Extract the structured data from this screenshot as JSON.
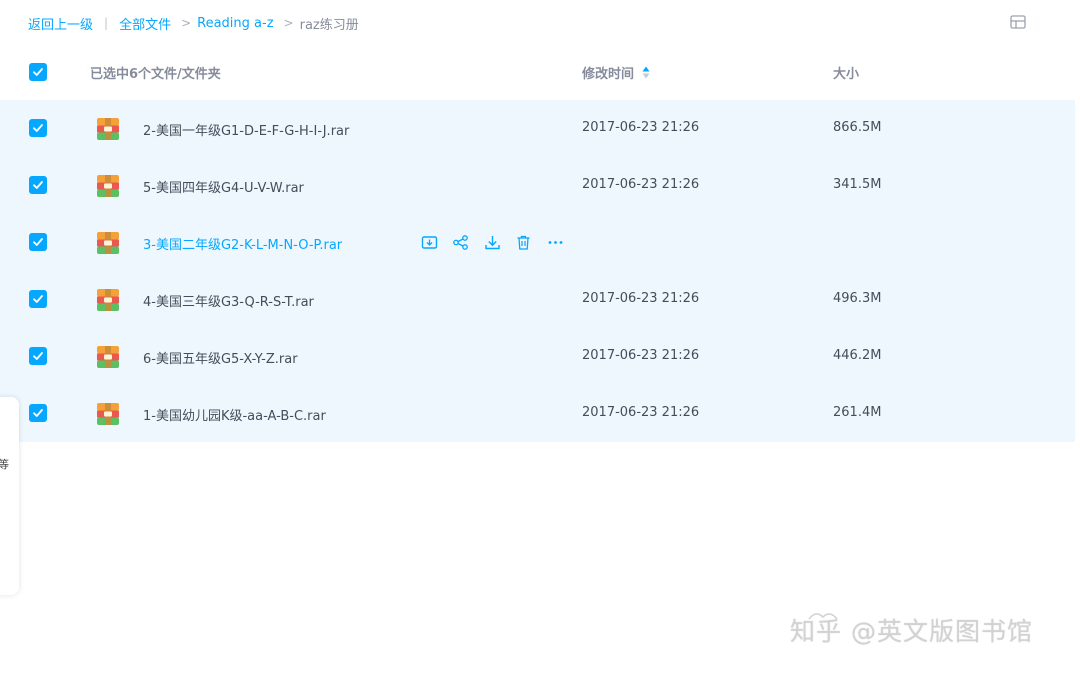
{
  "breadcrumb": {
    "back": "返回上一级",
    "separator": "|",
    "items": [
      "全部文件",
      "Reading a-z"
    ],
    "arrow": ">",
    "current": "raz练习册"
  },
  "header": {
    "selected_label": "已选中6个文件/文件夹",
    "time_label": "修改时间",
    "size_label": "大小"
  },
  "files": [
    {
      "name": "2-美国一年级G1-D-E-F-G-H-I-J.rar",
      "time": "2017-06-23 21:26",
      "size": "866.5M"
    },
    {
      "name": "5-美国四年级G4-U-V-W.rar",
      "time": "2017-06-23 21:26",
      "size": "341.5M"
    },
    {
      "name": "3-美国二年级G2-K-L-M-N-O-P.rar",
      "time": "",
      "size": ""
    },
    {
      "name": "4-美国三年级G3-Q-R-S-T.rar",
      "time": "2017-06-23 21:26",
      "size": "496.3M"
    },
    {
      "name": "6-美国五年级G5-X-Y-Z.rar",
      "time": "2017-06-23 21:26",
      "size": "446.2M"
    },
    {
      "name": "1-美国幼儿园K级-aa-A-B-C.rar",
      "time": "2017-06-23 21:26",
      "size": "261.4M"
    }
  ],
  "row_actions": [
    "save-to-netdisk-icon",
    "share-icon",
    "download-icon",
    "delete-icon",
    "more-icon"
  ],
  "side_mark": "等",
  "watermark": "知乎 @英文版图书馆",
  "colors": {
    "accent": "#06a7ff",
    "row_selected_bg": "#eef7fe",
    "muted_text": "#878c9c",
    "body_text": "#454d5a"
  }
}
